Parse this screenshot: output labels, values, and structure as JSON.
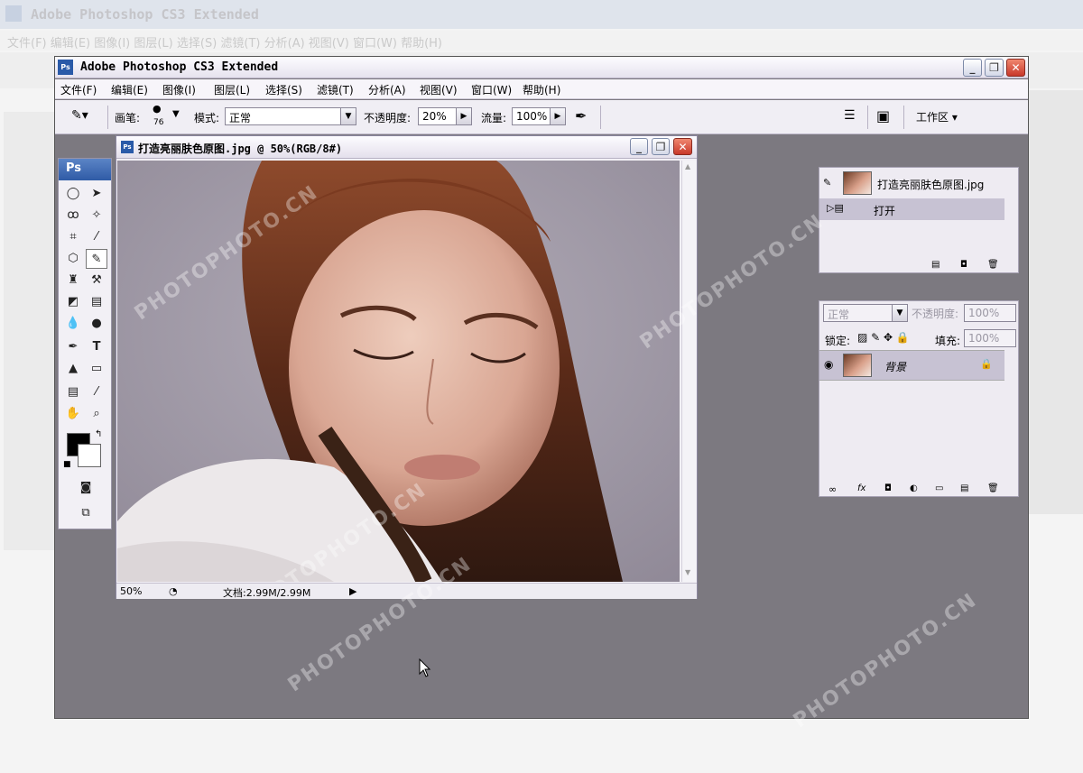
{
  "app": {
    "title": "Adobe Photoshop CS3 Extended",
    "ps_badge": "Ps",
    "menu": [
      "文件(F)",
      "编辑(E)",
      "图像(I)",
      "图层(L)",
      "选择(S)",
      "滤镜(T)",
      "分析(A)",
      "视图(V)",
      "窗口(W)",
      "帮助(H)"
    ],
    "window_buttons": {
      "minimize": "_",
      "maximize": "❐",
      "close": "✕"
    }
  },
  "background_window": {
    "title": "Adobe Photoshop CS3 Extended",
    "menu": "文件(F)  编辑(E)  图像(I)  图层(L)  选择(S)  滤镜(T)  分析(A)  视图(V)  窗口(W)  帮助(H)"
  },
  "options_bar": {
    "brush_label": "画笔:",
    "brush_size": "76",
    "mode_label": "模式:",
    "mode_value": "正常",
    "opacity_label": "不透明度:",
    "opacity_value": "20%",
    "flow_label": "流量:",
    "flow_value": "100%",
    "workspace_label": "工作区 ▾"
  },
  "toolbox": {
    "header": "Ps",
    "tools": [
      "marquee",
      "move",
      "lasso",
      "magic-wand",
      "crop",
      "slice",
      "healing",
      "brush",
      "stamp",
      "history-brush",
      "eraser",
      "gradient",
      "blur",
      "dodge",
      "pen",
      "type",
      "path-select",
      "shape",
      "notes",
      "eyedropper",
      "hand",
      "zoom"
    ],
    "foreground_color": "#000000",
    "background_color": "#ffffff"
  },
  "document": {
    "title": "打造亮丽肤色原图.jpg @ 50%(RGB/8#)",
    "zoom": "50%",
    "doc_info": "文档:2.99M/2.99M"
  },
  "history_panel": {
    "snapshot_name": "打造亮丽肤色原图.jpg",
    "steps": [
      "打开"
    ]
  },
  "layers_panel": {
    "blend_mode": "正常",
    "opacity_label": "不透明度:",
    "opacity_value": "100%",
    "lock_label": "锁定:",
    "fill_label": "填充:",
    "fill_value": "100%",
    "layers": [
      {
        "name": "背景",
        "locked": true,
        "visible": true
      }
    ]
  },
  "watermark": "PHOTOPHOTO.CN"
}
